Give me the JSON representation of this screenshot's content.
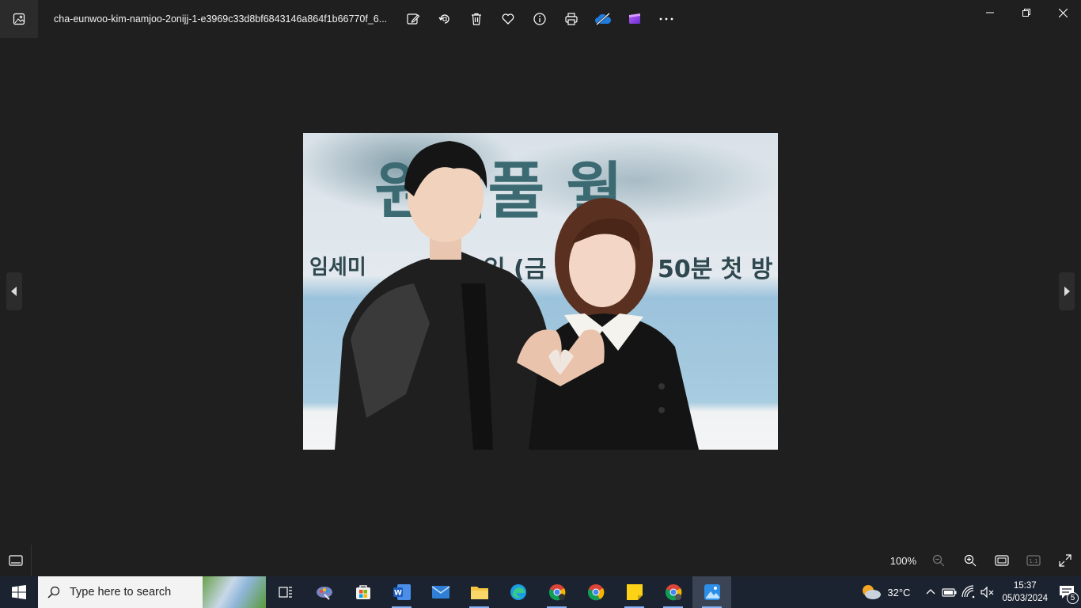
{
  "window": {
    "filename": "cha-eunwoo-kim-namjoo-2onijj-1-e3969c33d8bf6843146a864f1b66770f_6..."
  },
  "toolbar": {
    "buttons": [
      "edit-icon",
      "rotate-icon",
      "delete-icon",
      "favorite-icon",
      "info-icon",
      "print-icon",
      "onedrive-icon",
      "clipchamp-icon",
      "more-icon"
    ]
  },
  "zoom": {
    "level": "100%"
  },
  "photo": {
    "banner_text_top": "원더풀 월",
    "banner_text_mid": "임세미",
    "banner_text_right": "일 (금",
    "banner_text_time": "50분 첫 방"
  },
  "taskbar": {
    "search_placeholder": "Type here to search",
    "weather_temp": "32°C",
    "time": "15:37",
    "date": "05/03/2024",
    "notification_count": "5"
  },
  "colors": {
    "app_bg": "#1f1f1f",
    "taskbar_bg": "#1c2330",
    "accent": "#8ab4f8"
  }
}
